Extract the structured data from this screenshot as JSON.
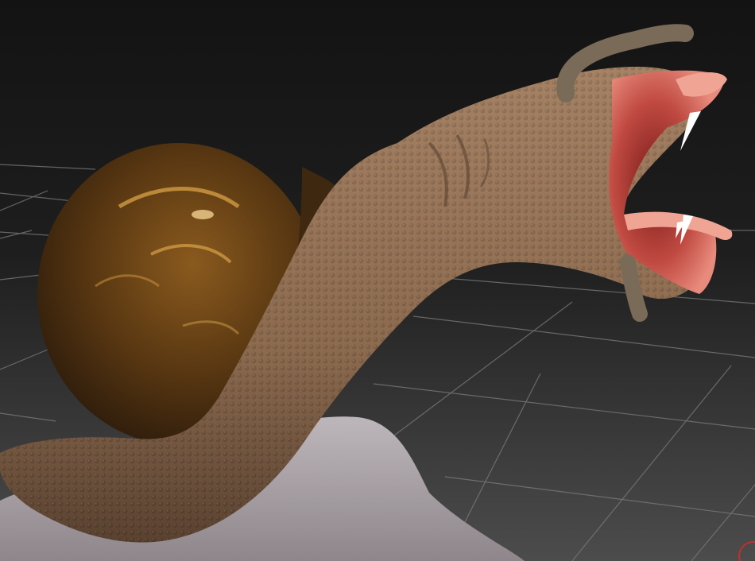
{
  "viewport": {
    "background_top": "#161616",
    "background_bottom": "#4a4a4a",
    "grid_color": "#8a8a8a"
  },
  "model": {
    "shell_color": "#5a3a14",
    "shell_highlight": "#d8a040",
    "skin_color": "#9a7658",
    "skin_shadow": "#4a3526",
    "mouth_color": "#e07a70",
    "tongue_color": "#f0a090",
    "fang_color": "#ffffff",
    "tentacle_color": "#7a6a58",
    "rock_color": "#a8a0a4"
  },
  "axis_gizmo": {
    "icon": "axis-gizmo-icon",
    "color": "#c03030"
  }
}
